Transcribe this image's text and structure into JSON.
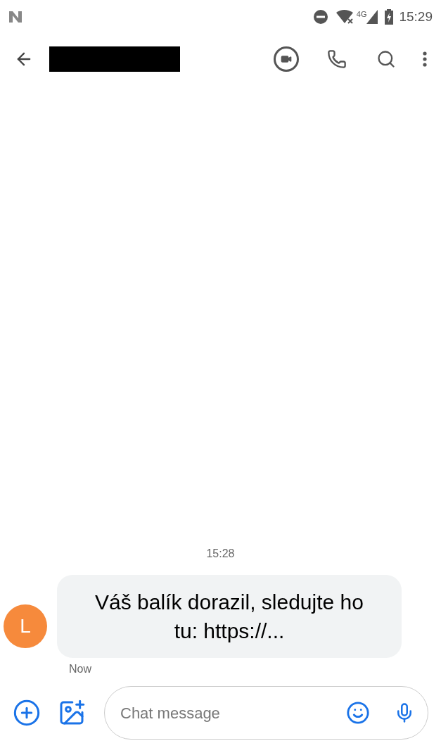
{
  "status_bar": {
    "network": "4G",
    "time": "15:29"
  },
  "conversation": {
    "timestamp": "15:28",
    "messages": [
      {
        "initial": "L",
        "text": "Váš balík dorazil, sledujte ho tu: https://...",
        "time": "Now"
      }
    ]
  },
  "compose": {
    "placeholder": "Chat message"
  }
}
